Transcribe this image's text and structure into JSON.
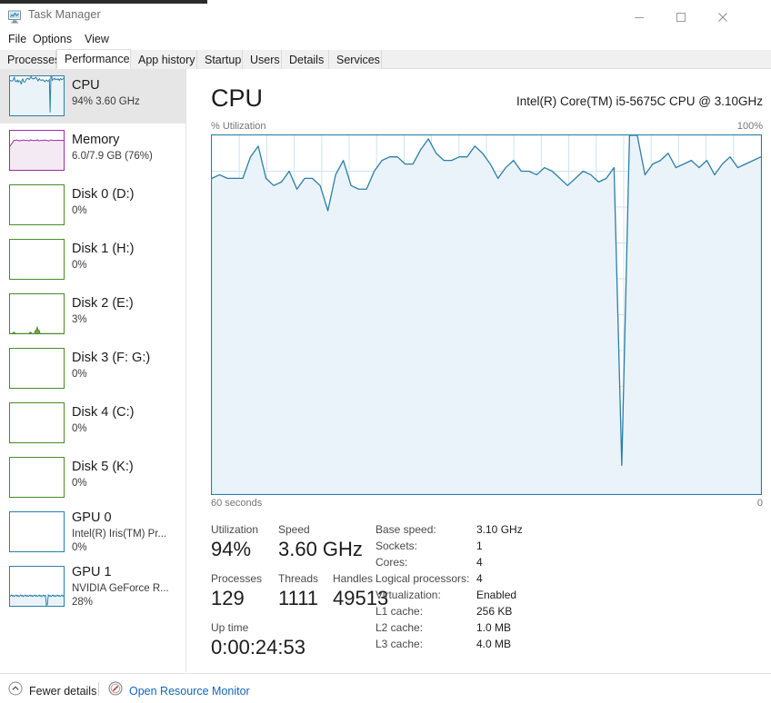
{
  "window": {
    "title": "Task Manager",
    "icon": "task-manager-icon",
    "minimize": "—",
    "maximize": "□",
    "close": "✕"
  },
  "menu": {
    "items": [
      "File",
      "Options",
      "View"
    ]
  },
  "tabs": [
    {
      "label": "Processes",
      "active": false
    },
    {
      "label": "Performance",
      "active": true
    },
    {
      "label": "App history",
      "active": false
    },
    {
      "label": "Startup",
      "active": false
    },
    {
      "label": "Users",
      "active": false
    },
    {
      "label": "Details",
      "active": false
    },
    {
      "label": "Services",
      "active": false
    }
  ],
  "sidebar": {
    "items": [
      {
        "name": "CPU",
        "sub": "94%  3.60 GHz",
        "sub2": "",
        "selected": true,
        "color": "#2a7fa8",
        "fill": "#e9f3f8",
        "graph": "cpu"
      },
      {
        "name": "Memory",
        "sub": "6.0/7.9 GB (76%)",
        "sub2": "",
        "selected": false,
        "color": "#a32ba3",
        "fill": "#f3eaf3",
        "graph": "memory"
      },
      {
        "name": "Disk 0 (D:)",
        "sub": "0%",
        "sub2": "",
        "selected": false,
        "color": "#4a8c28",
        "fill": "#ffffff",
        "graph": "flat"
      },
      {
        "name": "Disk 1 (H:)",
        "sub": "0%",
        "sub2": "",
        "selected": false,
        "color": "#4a8c28",
        "fill": "#ffffff",
        "graph": "flat"
      },
      {
        "name": "Disk 2 (E:)",
        "sub": "3%",
        "sub2": "",
        "selected": false,
        "color": "#4a8c28",
        "fill": "#ffffff",
        "graph": "disk2"
      },
      {
        "name": "Disk 3 (F: G:)",
        "sub": "0%",
        "sub2": "",
        "selected": false,
        "color": "#4a8c28",
        "fill": "#ffffff",
        "graph": "flat"
      },
      {
        "name": "Disk 4 (C:)",
        "sub": "0%",
        "sub2": "",
        "selected": false,
        "color": "#4a8c28",
        "fill": "#ffffff",
        "graph": "flat"
      },
      {
        "name": "Disk 5 (K:)",
        "sub": "0%",
        "sub2": "",
        "selected": false,
        "color": "#4a8c28",
        "fill": "#ffffff",
        "graph": "flat"
      },
      {
        "name": "GPU 0",
        "sub": "Intel(R) Iris(TM) Pr...",
        "sub2": "0%",
        "selected": false,
        "color": "#2a7fa8",
        "fill": "#ffffff",
        "graph": "flat"
      },
      {
        "name": "GPU 1",
        "sub": "NVIDIA GeForce R...",
        "sub2": "28%",
        "selected": false,
        "color": "#2a7fa8",
        "fill": "#e9f3f8",
        "graph": "gpu1"
      }
    ]
  },
  "main": {
    "title": "CPU",
    "model": "Intel(R) Core(TM) i5-5675C CPU @ 3.10GHz",
    "axis_top_left": "% Utilization",
    "axis_top_right": "100%",
    "axis_bottom_left": "60 seconds",
    "axis_bottom_right": "0",
    "stats": [
      {
        "label": "Utilization",
        "value": "94%"
      },
      {
        "label": "Speed",
        "value": "3.60 GHz"
      },
      {
        "label": "Processes",
        "value": "129"
      },
      {
        "label": "Threads",
        "value": "1111"
      },
      {
        "label": "Handles",
        "value": "49513"
      },
      {
        "label": "Up time",
        "value": "0:00:24:53"
      }
    ],
    "specs": [
      {
        "key": "Base speed:",
        "value": "3.10 GHz"
      },
      {
        "key": "Sockets:",
        "value": "1"
      },
      {
        "key": "Cores:",
        "value": "4"
      },
      {
        "key": "Logical processors:",
        "value": "4"
      },
      {
        "key": "Virtualization:",
        "value": "Enabled"
      },
      {
        "key": "L1 cache:",
        "value": "256 KB"
      },
      {
        "key": "L2 cache:",
        "value": "1.0 MB"
      },
      {
        "key": "L3 cache:",
        "value": "4.0 MB"
      }
    ]
  },
  "footer": {
    "fewer_details": "Fewer details",
    "fewer_icon": "chevron-up-icon",
    "resource_monitor": "Open Resource Monitor",
    "resource_monitor_icon": "resource-monitor-icon"
  },
  "colors": {
    "cpu_line": "#2a7fa8",
    "cpu_fill": "#eaf3f9",
    "grid": "#cfe3f0",
    "border": "#2a7fa8",
    "link": "#1266bd",
    "selected_bg": "#e6e6e6"
  },
  "chart_data": {
    "type": "area",
    "title": "CPU % Utilization",
    "xlabel": "60 seconds",
    "ylabel": "% Utilization",
    "ylim": [
      0,
      100
    ],
    "xlim": [
      60,
      0
    ],
    "grid": true,
    "grid_rows": 10,
    "grid_cols": 20,
    "legend": "none",
    "series": [
      {
        "name": "CPU Utilization",
        "values": [
          88,
          89,
          88,
          88,
          88,
          94,
          97,
          88,
          86,
          87,
          90,
          85,
          88,
          88,
          86,
          79,
          89,
          93,
          86,
          85,
          85,
          90,
          93,
          94,
          94,
          92,
          92,
          96,
          99,
          95,
          93,
          93,
          94,
          94,
          97,
          95,
          92,
          88,
          91,
          93,
          90,
          90,
          89,
          91,
          90,
          88,
          86,
          88,
          90,
          89,
          87,
          88,
          91,
          8,
          100,
          100,
          89,
          92,
          93,
          95,
          91,
          92,
          93,
          91,
          93,
          89,
          92,
          94,
          91,
          92,
          93,
          94
        ]
      }
    ]
  }
}
